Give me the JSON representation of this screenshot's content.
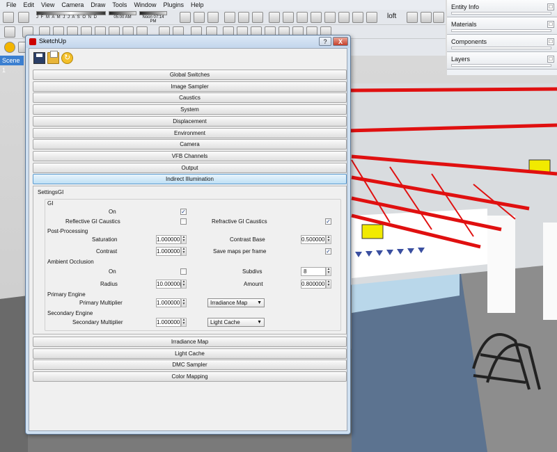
{
  "menubar": [
    "File",
    "Edit",
    "View",
    "Camera",
    "Draw",
    "Tools",
    "Window",
    "Plugins",
    "Help"
  ],
  "shadow_settings": {
    "months": "J F M A M J J A S O N D",
    "time_start": "05:00 AM",
    "noon": "Noon",
    "time_end": "07:14 PM"
  },
  "toolbar": {
    "loft_label": "loft"
  },
  "scene_tab": "Scene 1",
  "tray": [
    "Entity Info",
    "Materials",
    "Components",
    "Layers"
  ],
  "dialog": {
    "title": "SketchUp",
    "help_btn": "?",
    "close_btn": "X",
    "rollouts_top": [
      "Global Switches",
      "Image Sampler",
      "Caustics",
      "System",
      "Displacement",
      "Environment",
      "Camera",
      "VFB Channels",
      "Output",
      "Indirect Illumination"
    ],
    "rollouts_bottom": [
      "Irradiance Map",
      "Light Cache",
      "DMC Sampler",
      "Color Mapping"
    ],
    "gi": {
      "settings_title": "SettingsGI",
      "gi_group": "GI",
      "on_label": "On",
      "on_checked": true,
      "refl_label": "Reflective GI Caustics",
      "refl_checked": false,
      "refr_label": "Refractive GI Caustics",
      "refr_checked": true,
      "post_group": "Post-Processing",
      "saturation_label": "Saturation",
      "saturation": "1.000000",
      "contrast_base_label": "Contrast Base",
      "contrast_base": "0.500000",
      "contrast_label": "Contrast",
      "contrast": "1.000000",
      "save_maps_label": "Save maps per frame",
      "save_maps_checked": true,
      "ao_group": "Ambient Occlusion",
      "ao_on_label": "On",
      "ao_on_checked": false,
      "subdivs_label": "Subdivs",
      "subdivs": "8",
      "radius_label": "Radius",
      "radius": "10.00000(",
      "amount_label": "Amount",
      "amount": "0.800000",
      "primary_group": "Primary Engine",
      "primary_mult_label": "Primary Multiplier",
      "primary_mult": "1.000000",
      "primary_engine": "Irradiance Map",
      "secondary_group": "Secondary Engine",
      "secondary_mult_label": "Secondary Multiplier",
      "secondary_mult": "1.000000",
      "secondary_engine": "Light Cache"
    }
  },
  "colors": {
    "truss": "#e01010",
    "dialog_frame": "#cfe0f1",
    "active_rollout": "#bfe0f5",
    "scene_tab": "#3b7fd0"
  },
  "icons": [
    "save-icon",
    "open-folder-icon",
    "revert-icon",
    "close-icon",
    "help-icon"
  ]
}
